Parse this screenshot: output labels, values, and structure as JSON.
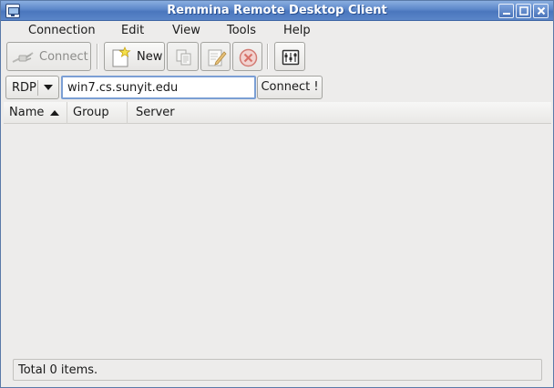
{
  "window": {
    "title": "Remmina Remote Desktop Client"
  },
  "menubar": {
    "items": [
      {
        "label": "Connection"
      },
      {
        "label": "Edit"
      },
      {
        "label": "View"
      },
      {
        "label": "Tools"
      },
      {
        "label": "Help"
      }
    ]
  },
  "toolbar": {
    "connect_label": "Connect",
    "connect_enabled": false,
    "new_label": "New",
    "icons": [
      "connect-icon",
      "new-icon",
      "copy-icon",
      "edit-icon",
      "delete-icon",
      "preferences-icon"
    ]
  },
  "quick_connect": {
    "protocol": "RDP",
    "server_value": "win7.cs.sunyit.edu",
    "connect_label": "Connect !"
  },
  "list": {
    "columns": [
      {
        "label": "Name",
        "sort": "ascending"
      },
      {
        "label": "Group"
      },
      {
        "label": "Server"
      }
    ],
    "rows": []
  },
  "status": {
    "text": "Total 0 items."
  },
  "colors": {
    "titlebar": "#5c87c9",
    "window_bg": "#edeceb",
    "input_focus_border": "#7b9fd4"
  }
}
